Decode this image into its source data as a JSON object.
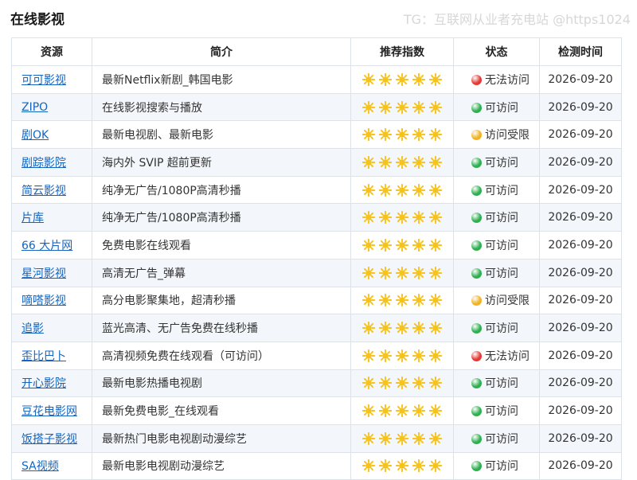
{
  "page": {
    "title": "在线影视",
    "watermark": "TG：互联网从业者充电站 @https1024"
  },
  "table": {
    "headers": [
      "资源",
      "简介",
      "推荐指数",
      "状态",
      "检测时间"
    ],
    "rows": [
      {
        "name": "可可影视",
        "desc": "最新Netflix新剧_韩国电影",
        "stars": 5,
        "status": "无法访问",
        "status_level": "down",
        "date": "2026-09-20"
      },
      {
        "name": "ZIPO",
        "desc": "在线影视搜索与播放",
        "stars": 5,
        "status": "可访问",
        "status_level": "ok",
        "date": "2026-09-20"
      },
      {
        "name": "剧OK",
        "desc": "最新电视剧、最新电影",
        "stars": 5,
        "status": "访问受限",
        "status_level": "limited",
        "date": "2026-09-20"
      },
      {
        "name": "剧踪影院",
        "desc": "海内外 SVIP 超前更新",
        "stars": 5,
        "status": "可访问",
        "status_level": "ok",
        "date": "2026-09-20"
      },
      {
        "name": "简云影视",
        "desc": "纯净无广告/1080P高清秒播",
        "stars": 5,
        "status": "可访问",
        "status_level": "ok",
        "date": "2026-09-20"
      },
      {
        "name": "片库",
        "desc": "纯净无广告/1080P高清秒播",
        "stars": 5,
        "status": "可访问",
        "status_level": "ok",
        "date": "2026-09-20"
      },
      {
        "name": "66 大片网",
        "desc": "免费电影在线观看",
        "stars": 5,
        "status": "可访问",
        "status_level": "ok",
        "date": "2026-09-20"
      },
      {
        "name": "星河影视",
        "desc": "高清无广告_弹幕",
        "stars": 5,
        "status": "可访问",
        "status_level": "ok",
        "date": "2026-09-20"
      },
      {
        "name": "嘀嗒影视",
        "desc": "高分电影聚集地，超清秒播",
        "stars": 5,
        "status": "访问受限",
        "status_level": "limited",
        "date": "2026-09-20"
      },
      {
        "name": "追影",
        "desc": "蓝光高清、无广告免费在线秒播",
        "stars": 5,
        "status": "可访问",
        "status_level": "ok",
        "date": "2026-09-20"
      },
      {
        "name": "歪比巴卜",
        "desc": "高清视频免费在线观看（可访问）",
        "stars": 5,
        "status": "无法访问",
        "status_level": "down",
        "date": "2026-09-20"
      },
      {
        "name": "开心影院",
        "desc": "最新电影热播电视剧",
        "stars": 5,
        "status": "可访问",
        "status_level": "ok",
        "date": "2026-09-20"
      },
      {
        "name": "豆花电影网",
        "desc": "最新免费电影_在线观看",
        "stars": 5,
        "status": "可访问",
        "status_level": "ok",
        "date": "2026-09-20"
      },
      {
        "name": "饭搭子影视",
        "desc": "最新热门电影电视剧动漫综艺",
        "stars": 5,
        "status": "可访问",
        "status_level": "ok",
        "date": "2026-09-20"
      },
      {
        "name": "SA视频",
        "desc": "最新电影电视剧动漫综艺",
        "stars": 5,
        "status": "可访问",
        "status_level": "ok",
        "date": "2026-09-20"
      }
    ]
  },
  "colors": {
    "link": "#1565c0",
    "status_ok": "#2eb050",
    "status_limited": "#f0b323",
    "status_down": "#e53935",
    "star": "#f6c21c"
  },
  "icons": {
    "rating": "sun-star-icon",
    "status": "status-dot-icon"
  }
}
